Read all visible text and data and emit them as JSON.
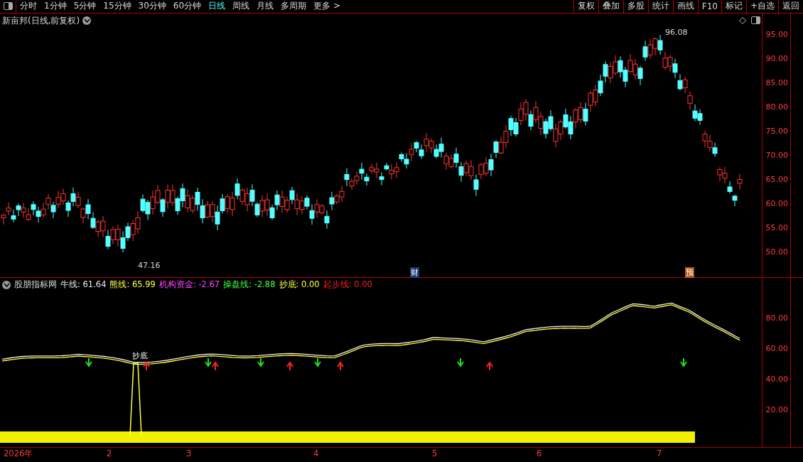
{
  "toolbar": {
    "periods": [
      {
        "label": "分时",
        "selected": false
      },
      {
        "label": "1分钟",
        "selected": false
      },
      {
        "label": "5分钟",
        "selected": false
      },
      {
        "label": "15分钟",
        "selected": false
      },
      {
        "label": "30分钟",
        "selected": false
      },
      {
        "label": "60分钟",
        "selected": false
      },
      {
        "label": "日线",
        "selected": true
      },
      {
        "label": "周线",
        "selected": false
      },
      {
        "label": "月线",
        "selected": false
      },
      {
        "label": "多周期",
        "selected": false
      },
      {
        "label": "更多 >",
        "selected": false
      }
    ],
    "buttons": [
      "复权",
      "叠加",
      "多股",
      "统计",
      "画线",
      "F10",
      "标记",
      "+自选",
      "返回"
    ]
  },
  "price_panel": {
    "title": "新亩邦(日线,前复权)",
    "high_label": "96.08",
    "low_label": "47.16",
    "markers": [
      "财",
      "预"
    ],
    "y_axis": [
      "95.00",
      "90.00",
      "85.00",
      "80.00",
      "75.00",
      "70.00",
      "65.00",
      "60.00",
      "55.00",
      "50.00"
    ]
  },
  "indicator_panel": {
    "title": "股朋指标网",
    "legend": [
      {
        "name": "牛线:",
        "value": "61.64",
        "color": "#e8e8e8"
      },
      {
        "name": "熊线:",
        "value": "65.99",
        "color": "#ffff40"
      },
      {
        "name": "机构资金:",
        "value": "-2.67",
        "color": "#ff40ff"
      },
      {
        "name": "操盘线:",
        "value": "-2.88",
        "color": "#40ff40"
      },
      {
        "name": "抄底:",
        "value": "0.00",
        "color": "#ffff40"
      },
      {
        "name": "起步线:",
        "value": "0.00",
        "color": "#ff2020"
      }
    ],
    "bottom_label": "抄底",
    "y_axis": [
      "80.00",
      "60.00",
      "40.00",
      "20.00"
    ]
  },
  "date_axis": [
    "2026年",
    "2",
    "3",
    "4",
    "5",
    "6",
    "7"
  ]
}
